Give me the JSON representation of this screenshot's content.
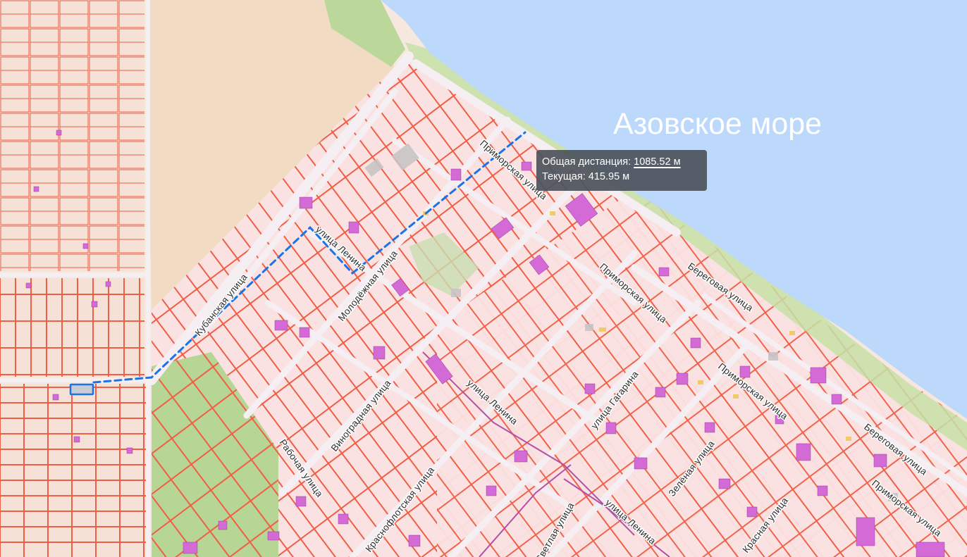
{
  "map": {
    "sea_label": "Азовское море",
    "colors": {
      "sea": "#bcd8fb",
      "land": "#f6e8de",
      "parcel_fill": "#fbe4e4",
      "parcel_border": "#ef5e45",
      "green": "#b9d79a",
      "sand": "#f0dcc4",
      "building": "#d36ad6",
      "route": "#1a73e8",
      "road": "#f4eef0"
    },
    "streets": [
      {
        "id": "primorskaya-1",
        "name": "Приморская улица"
      },
      {
        "id": "primorskaya-2",
        "name": "Приморская улица"
      },
      {
        "id": "primorskaya-3",
        "name": "Приморская улица"
      },
      {
        "id": "primorskaya-4",
        "name": "Приморская улица"
      },
      {
        "id": "beregovaya-1",
        "name": "Береговая улица"
      },
      {
        "id": "beregovaya-2",
        "name": "Береговая улица"
      },
      {
        "id": "kubanskaya",
        "name": "Кубанская улица"
      },
      {
        "id": "lenina-1",
        "name": "улица Ленина"
      },
      {
        "id": "lenina-2",
        "name": "улица Ленина"
      },
      {
        "id": "lenina-3",
        "name": "улица Ленина"
      },
      {
        "id": "molodyozhnaya",
        "name": "Молодёжная улица"
      },
      {
        "id": "vinogradnaya",
        "name": "Виноградная улица"
      },
      {
        "id": "rabochaya",
        "name": "Рабочая улица"
      },
      {
        "id": "krasnoflotskaya",
        "name": "Краснофлотская улица"
      },
      {
        "id": "gagarina",
        "name": "улица Гагарина"
      },
      {
        "id": "zelyonaya",
        "name": "Зелёная улица"
      },
      {
        "id": "krasnaya",
        "name": "Красная улица"
      },
      {
        "id": "svetlaya",
        "name": "Светлая улица"
      }
    ]
  },
  "measurement": {
    "total_label": "Общая дистанция:",
    "total_value": "1085.52 м",
    "current_label": "Текущая:",
    "current_value": "415.95 м"
  }
}
